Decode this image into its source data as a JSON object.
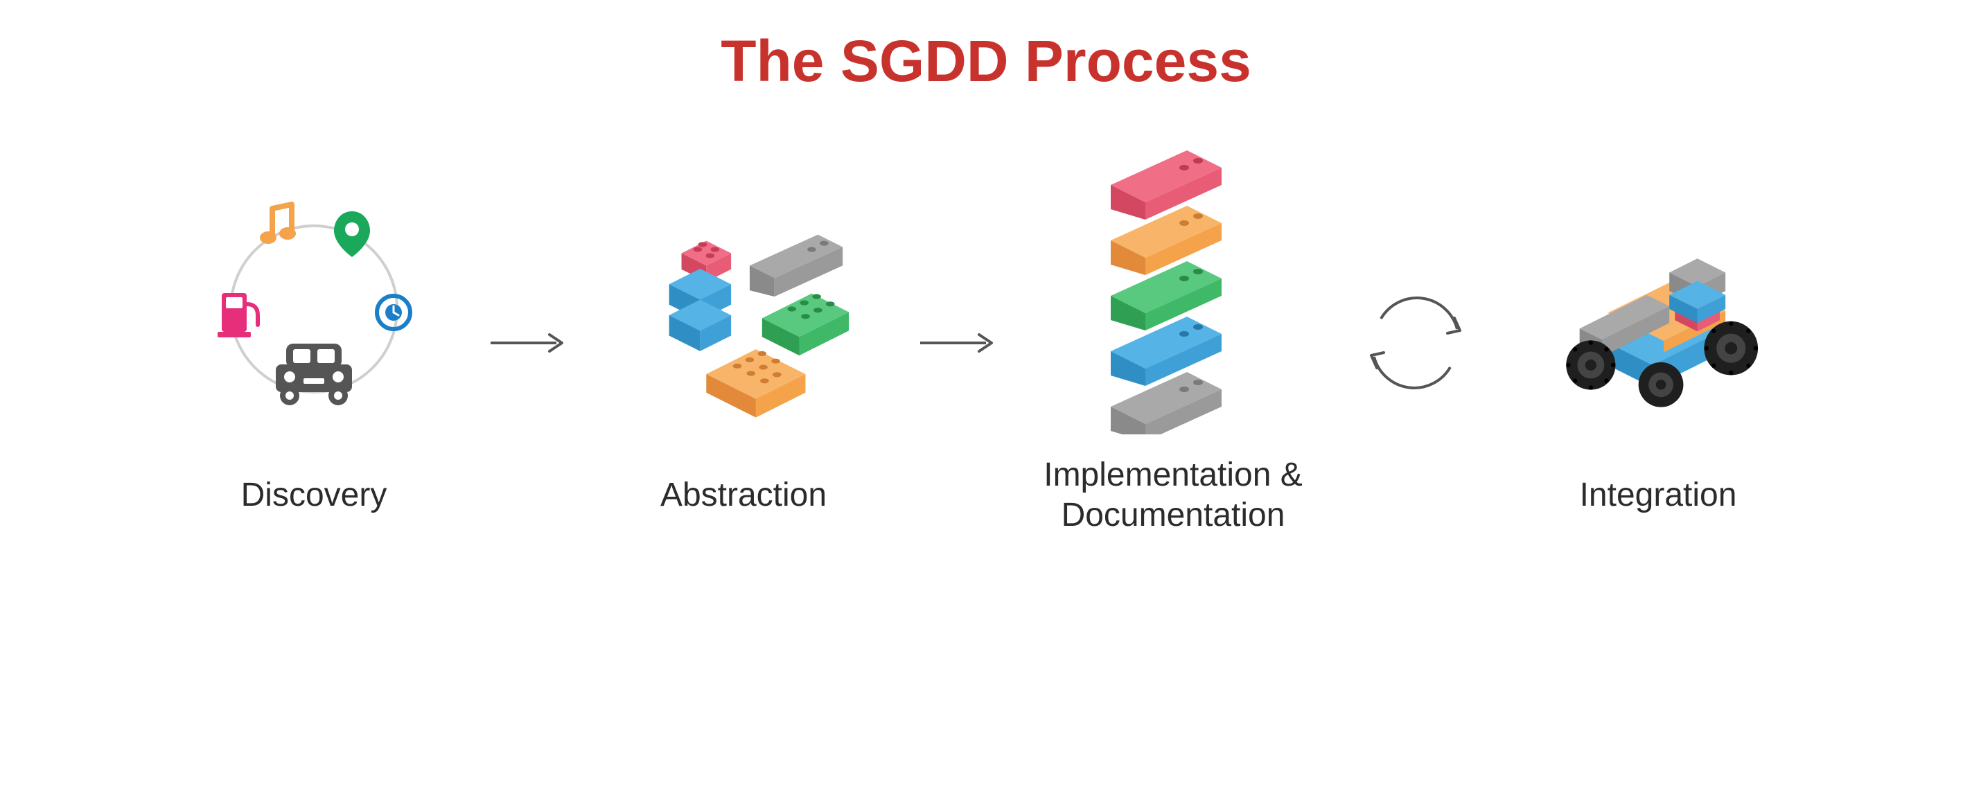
{
  "title": "The SGDD Process",
  "steps": [
    {
      "label": "Discovery"
    },
    {
      "label": "Abstraction"
    },
    {
      "label": "Implementation &\nDocumentation"
    },
    {
      "label": "Integration"
    }
  ],
  "colors": {
    "title": "#c8322d",
    "text": "#2b2b2b",
    "arrow": "#555555",
    "red": "#e84f6b",
    "blue": "#3ea0d6",
    "green": "#3fb968",
    "orange": "#f5a34a",
    "gray": "#8f8f8f",
    "pink": "#e62e7b",
    "music": "#f5a34a",
    "pin": "#1aa85a",
    "clock": "#1a7fc8",
    "car": "#555555",
    "wheel": "#222222"
  }
}
